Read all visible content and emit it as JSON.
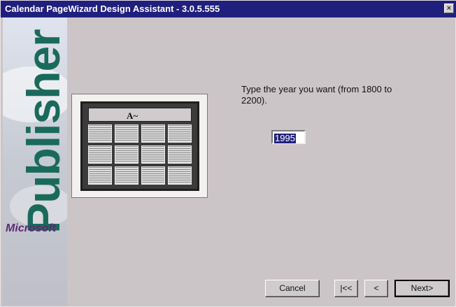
{
  "window": {
    "title": "Calendar PageWizard Design Assistant - 3.0.5.555",
    "close_label": "×"
  },
  "sidebar": {
    "product": "Publisher",
    "brand": "Microsoft"
  },
  "preview": {
    "header_mark": "A~"
  },
  "form": {
    "prompt": "Type the year you want (from 1800 to 2200).",
    "year_value": "1995"
  },
  "buttons": {
    "cancel": "Cancel",
    "first": "|<<",
    "back": "<",
    "next": "Next>"
  },
  "colors": {
    "titlebar": "#201f7e",
    "background": "#ccc5c7",
    "brand_green": "#1a6a5c",
    "brand_purple": "#5c2a73"
  }
}
